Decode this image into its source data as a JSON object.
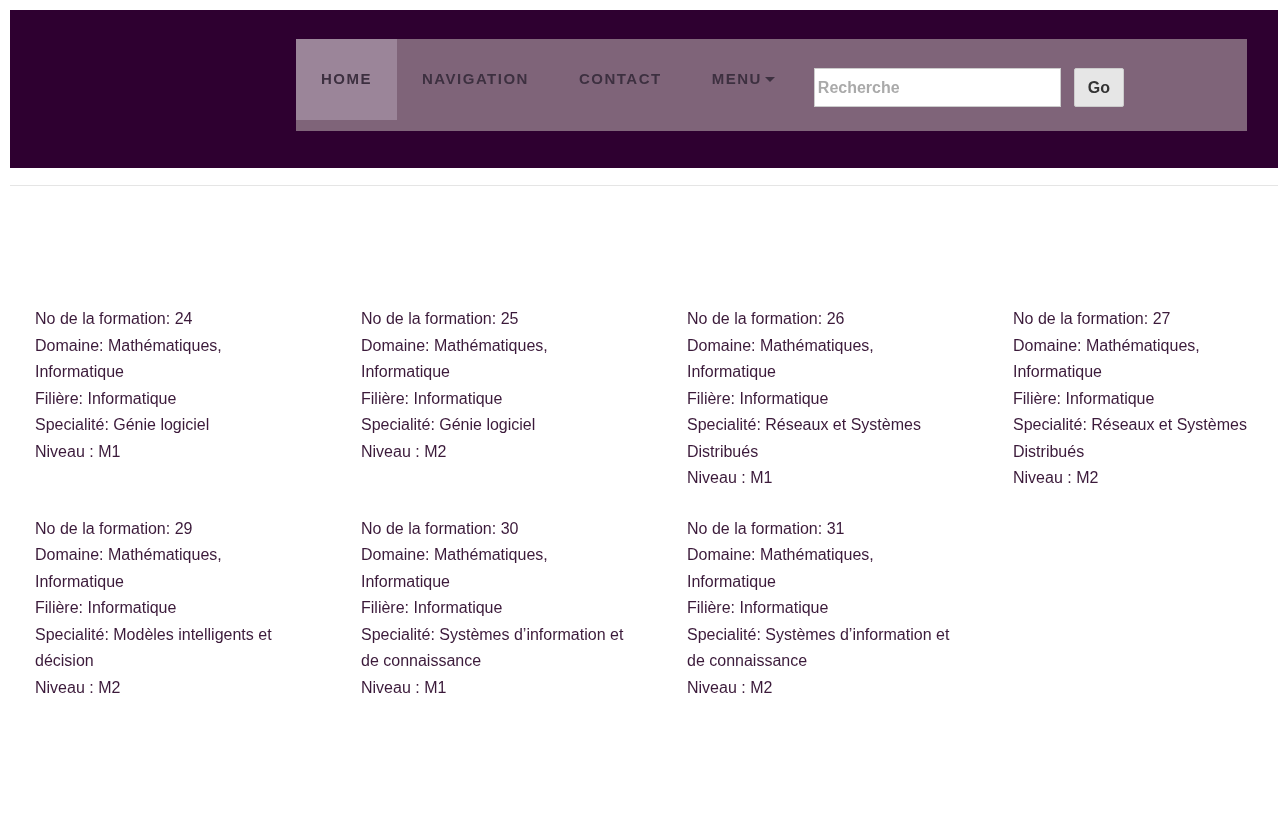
{
  "nav": {
    "items": [
      {
        "label": "HOME",
        "selected": true,
        "kind": "link"
      },
      {
        "label": "NAVIGATION",
        "selected": false,
        "kind": "link"
      },
      {
        "label": "CONTACT",
        "selected": false,
        "kind": "link"
      },
      {
        "label": "MENU",
        "selected": false,
        "kind": "dropdown"
      }
    ],
    "search": {
      "placeholder": "Recherche",
      "button": "Go"
    }
  },
  "formations": [
    {
      "number": "No de la formation: 24",
      "domaine": "Domaine: Mathématiques, Informatique",
      "filiere": "Filière: Informatique",
      "specialite": "Specialité: Génie logiciel",
      "niveau": "Niveau : M1"
    },
    {
      "number": "No de la formation: 25",
      "domaine": "Domaine: Mathématiques, Informatique",
      "filiere": "Filière: Informatique",
      "specialite": "Specialité: Génie logiciel",
      "niveau": "Niveau : M2"
    },
    {
      "number": "No de la formation: 26",
      "domaine": "Domaine: Mathématiques, Informatique",
      "filiere": "Filière: Informatique",
      "specialite": "Specialité: Réseaux et Systèmes Distribués",
      "niveau": "Niveau : M1"
    },
    {
      "number": "No de la formation: 27",
      "domaine": "Domaine: Mathématiques, Informatique",
      "filiere": "Filière: Informatique",
      "specialite": "Specialité: Réseaux et Systèmes Distribués",
      "niveau": "Niveau : M2"
    },
    {
      "number": "No de la formation: 29",
      "domaine": "Domaine: Mathématiques, Informatique",
      "filiere": "Filière: Informatique",
      "specialite": "Specialité: Modèles intelligents et décision",
      "niveau": "Niveau : M2"
    },
    {
      "number": "No de la formation: 30",
      "domaine": "Domaine: Mathématiques, Informatique",
      "filiere": "Filière: Informatique",
      "specialite": "Specialité: Systèmes d’information et de connaissance",
      "niveau": "Niveau : M1"
    },
    {
      "number": "No de la formation: 31",
      "domaine": "Domaine: Mathématiques, Informatique",
      "filiere": "Filière: Informatique",
      "specialite": "Specialité: Systèmes d’information et de connaissance",
      "niveau": "Niveau : M2"
    }
  ]
}
